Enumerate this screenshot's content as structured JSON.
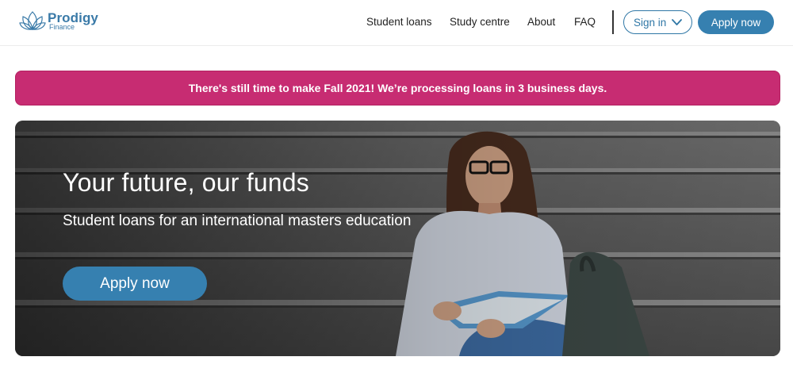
{
  "brand": {
    "name": "Prodigy",
    "sub": "Finance"
  },
  "nav": {
    "items": [
      {
        "label": "Student loans"
      },
      {
        "label": "Study centre"
      },
      {
        "label": "About"
      },
      {
        "label": "FAQ"
      }
    ],
    "signin_label": "Sign in",
    "apply_label": "Apply now"
  },
  "banner": {
    "text": "There's still time to make Fall 2021! We’re processing loans in 3 business days."
  },
  "hero": {
    "title": "Your future, our funds",
    "subtitle": "Student loans for an international masters education",
    "cta_label": "Apply now"
  },
  "colors": {
    "brand_blue": "#3680b0",
    "banner_pink": "#c72c72"
  }
}
